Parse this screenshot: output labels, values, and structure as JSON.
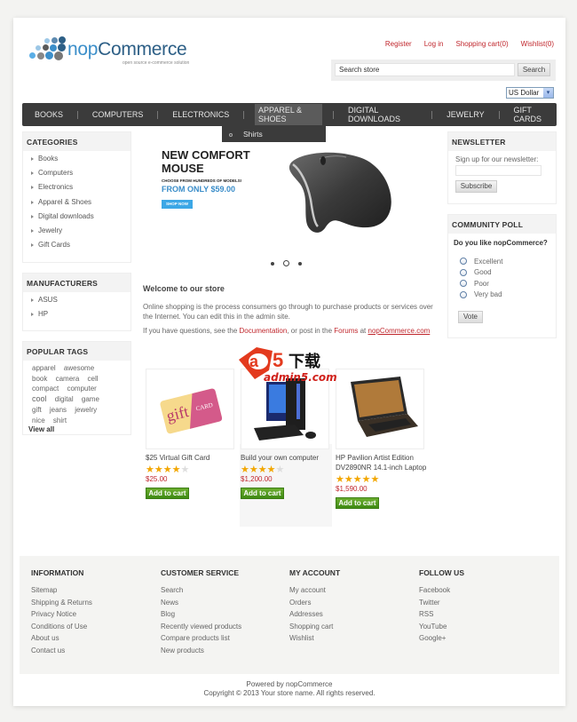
{
  "header": {
    "logo_text_light": "nop",
    "logo_text_dark": "Commerce",
    "logo_tagline": "open source e-commerce solution",
    "links": [
      "Register",
      "Log in",
      "Shopping cart(0)",
      "Wishlist(0)"
    ],
    "search_placeholder": "Search store",
    "search_button": "Search",
    "currency": "US Dollar"
  },
  "nav": {
    "items": [
      "BOOKS",
      "COMPUTERS",
      "ELECTRONICS",
      "APPAREL & SHOES",
      "DIGITAL DOWNLOADS",
      "JEWELRY",
      "GIFT CARDS"
    ],
    "active": "APPAREL & SHOES",
    "dropdown_items": [
      "Shirts"
    ]
  },
  "sidebar_left": {
    "categories_title": "CATEGORIES",
    "categories": [
      "Books",
      "Computers",
      "Electronics",
      "Apparel & Shoes",
      "Digital downloads",
      "Jewelry",
      "Gift Cards"
    ],
    "manufacturers_title": "MANUFACTURERS",
    "manufacturers": [
      "ASUS",
      "HP"
    ],
    "tags_title": "POPULAR TAGS",
    "tags": [
      "apparel",
      "awesome",
      "book",
      "camera",
      "cell",
      "compact",
      "computer",
      "cool",
      "digital",
      "game",
      "gift",
      "jeans",
      "jewelry",
      "nice",
      "shirt"
    ],
    "view_all": "View all"
  },
  "slider": {
    "headline_1": "NEW COMFORT",
    "headline_2": "MOUSE",
    "subline": "CHOOSE FROM HUNDREDS OF MODELS!",
    "price_line": "FROM ONLY $59.00",
    "button": "SHOP NOW",
    "slide_count": 3,
    "active_slide": 2
  },
  "welcome": {
    "title": "Welcome to our store",
    "paragraph": "Online shopping is the process consumers go through to purchase products or services over the Internet. You can edit this in the admin site.",
    "p2_prefix": "If you have questions, see the ",
    "p2_link1": "Documentation",
    "p2_mid": ", or post in the ",
    "p2_link2": "Forums",
    "p2_at": " at ",
    "p2_link3": "nopCommerce.com"
  },
  "watermark": {
    "big": "a5",
    "cn": "下载",
    "domain": "admin5.com"
  },
  "products": [
    {
      "name": "$25 Virtual Gift Card",
      "rating": 4,
      "max_rating": 5,
      "price": "$25.00",
      "button": "Add to cart"
    },
    {
      "name": "Build your own computer",
      "rating": 4,
      "max_rating": 5,
      "price": "$1,200.00",
      "button": "Add to cart"
    },
    {
      "name": "HP Pavilion Artist Edition DV2890NR 14.1-inch Laptop",
      "rating": 5,
      "max_rating": 5,
      "price": "$1,590.00",
      "button": "Add to cart"
    }
  ],
  "sidebar_right": {
    "newsletter_title": "NEWSLETTER",
    "newsletter_text": "Sign up for our newsletter:",
    "subscribe": "Subscribe",
    "poll_title": "COMMUNITY POLL",
    "poll_question": "Do you like nopCommerce?",
    "poll_options": [
      "Excellent",
      "Good",
      "Poor",
      "Very bad"
    ],
    "vote": "Vote"
  },
  "footer": {
    "columns": [
      {
        "title": "INFORMATION",
        "links": [
          "Sitemap",
          "Shipping & Returns",
          "Privacy Notice",
          "Conditions of Use",
          "About us",
          "Contact us"
        ]
      },
      {
        "title": "CUSTOMER SERVICE",
        "links": [
          "Search",
          "News",
          "Blog",
          "Recently viewed products",
          "Compare products list",
          "New products"
        ]
      },
      {
        "title": "MY ACCOUNT",
        "links": [
          "My account",
          "Orders",
          "Addresses",
          "Shopping cart",
          "Wishlist"
        ]
      },
      {
        "title": "FOLLOW US",
        "links": [
          "Facebook",
          "Twitter",
          "RSS",
          "YouTube",
          "Google+"
        ]
      }
    ],
    "powered_by": "Powered by nopCommerce",
    "copyright": "Copyright © 2013 Your store name. All rights reserved."
  },
  "colors": {
    "accent_red": "#c0272d",
    "nav_bg": "#3b3b3b",
    "logo_blue": "#3c8fca",
    "cart_green": "#4f9a1f",
    "star": "#f2a600"
  }
}
